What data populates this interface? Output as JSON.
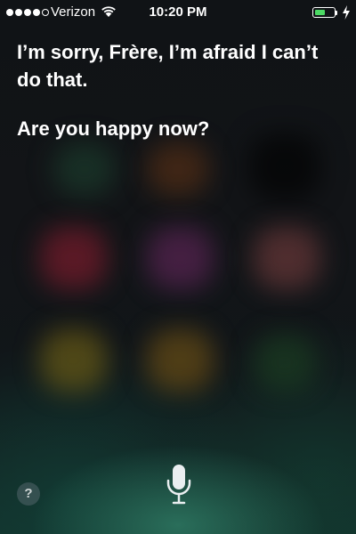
{
  "status_bar": {
    "carrier": "Verizon",
    "time": "10:20 PM",
    "signal_bars_filled": 4,
    "signal_bars_total": 5,
    "battery_level": 0.55,
    "battery_color": "#4cd964",
    "charging": true,
    "icons": [
      "signal-dots-icon",
      "wifi-icon",
      "battery-icon",
      "charging-bolt-icon"
    ]
  },
  "siri": {
    "response": "I’m sorry, Frère, I’m afraid I can’t do that.",
    "question": "Are you happy now?",
    "help_label": "?",
    "mic_icon": "microphone-icon"
  }
}
